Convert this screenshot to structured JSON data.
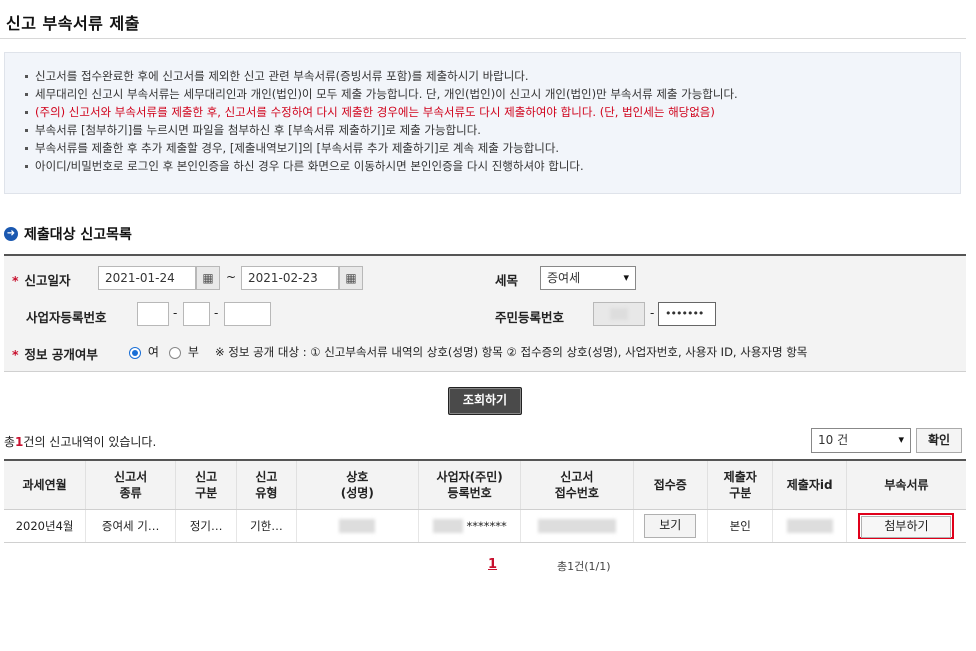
{
  "page": {
    "title": "신고 부속서류 제출"
  },
  "notice": {
    "lines": [
      "신고서를 접수완료한 후에 신고서를 제외한 신고 관련 부속서류(증빙서류 포함)를 제출하시기 바랍니다.",
      "세무대리인 신고시 부속서류는 세무대리인과 개인(법인)이 모두 제출 가능합니다. 단, 개인(법인)이 신고시 개인(법인)만 부속서류 제출 가능합니다.",
      "(주의) 신고서와 부속서류를 제출한 후, 신고서를 수정하여 다시 제출한 경우에는 부속서류도 다시 제출하여야 합니다. (단, 법인세는 해당없음)",
      "부속서류 [첨부하기]를 누르시면 파일을 첨부하신 후 [부속서류 제출하기]로 제출 가능합니다.",
      "부속서류를 제출한 후 추가 제출할 경우, [제출내역보기]의 [부속서류 추가 제출하기]로 계속 제출 가능합니다.",
      "아이디/비밀번호로 로그인 후 본인인증을 하신 경우 다른 화면으로 이동하시면 본인인증을 다시 진행하셔야 합니다."
    ],
    "warn_color": "#d0021b"
  },
  "section": {
    "title": "제출대상 신고목록",
    "icon": "arrow-circle-icon"
  },
  "filter": {
    "report_date_label": "신고일자",
    "date_from": "2021-01-24",
    "date_sep": "~",
    "date_to": "2021-02-23",
    "calendar_icon": "calendar-icon",
    "tax_label": "세목",
    "tax_value": "증여세",
    "bizno_label": "사업자등록번호",
    "dash": "-",
    "rrn_label": "주민등록번호",
    "rrn_back": "•••••••",
    "disclose_label": "정보 공개여부",
    "yes_label": "여",
    "no_label": "부",
    "disclose_selected": "여",
    "disclose_note": "※ 정보 공개 대상 : ① 신고부속서류 내역의 상호(성명) 항목 ② 접수증의 상호(성명), 사업자번호, 사용자 ID, 사용자명 항목",
    "required_mark": "*"
  },
  "search_button": "조회하기",
  "result": {
    "count_prefix": "총",
    "count": "1",
    "count_suffix": "건의 신고내역이 있습니다.",
    "page_size": "10 건",
    "confirm_button": "확인"
  },
  "table": {
    "headers": [
      "과세연월",
      [
        "신고서",
        "종류"
      ],
      [
        "신고",
        "구분"
      ],
      [
        "신고",
        "유형"
      ],
      [
        "상호",
        "(성명)"
      ],
      [
        "사업자(주민)",
        "등록번호"
      ],
      [
        "신고서",
        "접수번호"
      ],
      "접수증",
      [
        "제출자",
        "구분"
      ],
      "제출자id",
      "부속서류"
    ],
    "row": {
      "period": "2020년4월",
      "kind": "증여세 기…",
      "category": "정기…",
      "type": "기한…",
      "reg_no_suffix": "*******",
      "receipt_button": "보기",
      "submitter_type": "본인",
      "attach_button": "첨부하기"
    },
    "highlight_color": "#e0001a"
  },
  "pagination": {
    "current": "1",
    "info": "총1건(1/1)"
  }
}
